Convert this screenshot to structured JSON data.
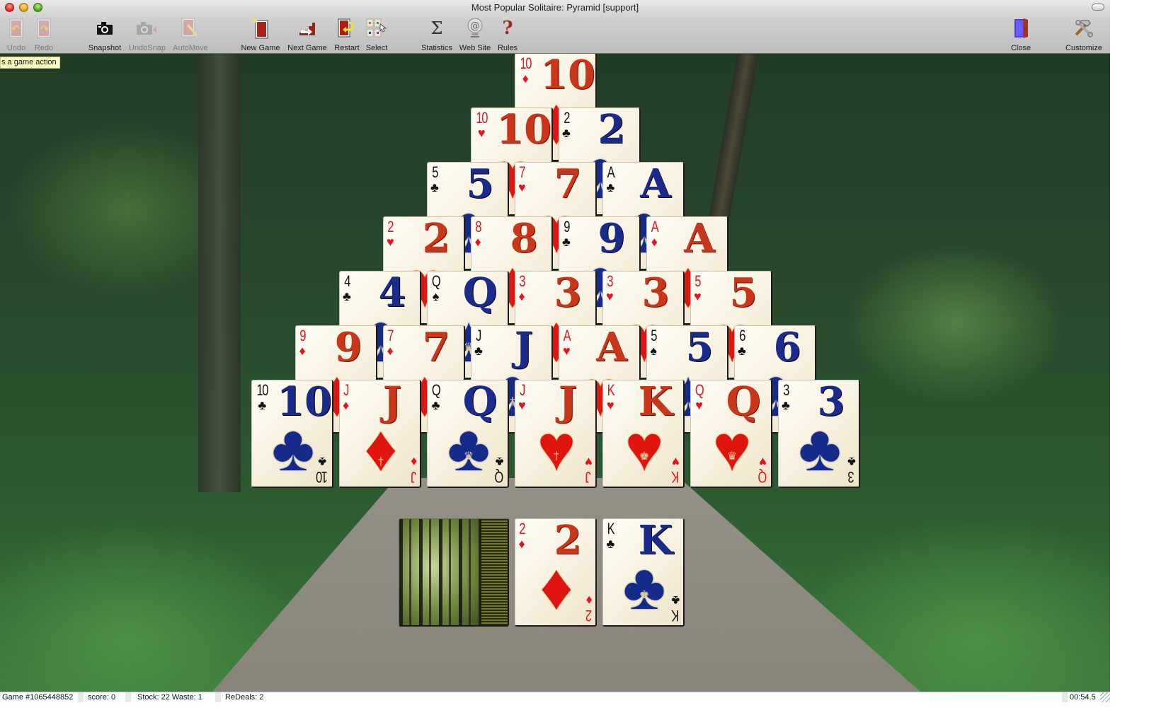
{
  "window": {
    "title": "Most Popular Solitaire: Pyramid [support]"
  },
  "toolbar": {
    "buttons": [
      {
        "id": "undo",
        "label": "Undo",
        "icon": "undo-icon",
        "enabled": false
      },
      {
        "id": "redo",
        "label": "Redo",
        "icon": "redo-icon",
        "enabled": false
      },
      {
        "id": "snapshot",
        "label": "Snapshot",
        "icon": "camera-icon",
        "enabled": true
      },
      {
        "id": "undosnap",
        "label": "UndoSnap",
        "icon": "camera-undo-icon",
        "enabled": false
      },
      {
        "id": "automove",
        "label": "AutoMove",
        "icon": "automove-icon",
        "enabled": false
      },
      {
        "id": "new-game",
        "label": "New Game",
        "icon": "new-game-icon",
        "enabled": true
      },
      {
        "id": "next-game",
        "label": "Next Game",
        "icon": "next-game-icon",
        "enabled": true
      },
      {
        "id": "restart",
        "label": "Restart",
        "icon": "restart-icon",
        "enabled": true
      },
      {
        "id": "select",
        "label": "Select",
        "icon": "select-icon",
        "enabled": true
      },
      {
        "id": "statistics",
        "label": "Statistics",
        "icon": "sigma-icon",
        "enabled": true
      },
      {
        "id": "web-site",
        "label": "Web Site",
        "icon": "at-sign-icon",
        "enabled": true
      },
      {
        "id": "rules",
        "label": "Rules",
        "icon": "question-mark-icon",
        "enabled": true
      },
      {
        "id": "close",
        "label": "Close",
        "icon": "door-icon",
        "enabled": true
      },
      {
        "id": "customize",
        "label": "Customize",
        "icon": "tools-icon",
        "enabled": true
      }
    ]
  },
  "tooltip": {
    "text": "s a game action"
  },
  "suits": {
    "hearts": {
      "glyph": "♥",
      "color": "red"
    },
    "diamonds": {
      "glyph": "♦",
      "color": "red"
    },
    "clubs": {
      "glyph": "♣",
      "color": "black"
    },
    "spades": {
      "glyph": "♠",
      "color": "black"
    }
  },
  "pyramid": {
    "rows": [
      [
        {
          "rank": "10",
          "suit": "diamonds"
        }
      ],
      [
        {
          "rank": "10",
          "suit": "hearts"
        },
        {
          "rank": "2",
          "suit": "clubs"
        }
      ],
      [
        {
          "rank": "5",
          "suit": "clubs"
        },
        {
          "rank": "7",
          "suit": "hearts"
        },
        {
          "rank": "A",
          "suit": "clubs"
        }
      ],
      [
        {
          "rank": "2",
          "suit": "hearts"
        },
        {
          "rank": "8",
          "suit": "diamonds"
        },
        {
          "rank": "9",
          "suit": "clubs"
        },
        {
          "rank": "A",
          "suit": "diamonds"
        }
      ],
      [
        {
          "rank": "4",
          "suit": "clubs"
        },
        {
          "rank": "Q",
          "suit": "spades"
        },
        {
          "rank": "3",
          "suit": "diamonds"
        },
        {
          "rank": "3",
          "suit": "hearts"
        },
        {
          "rank": "5",
          "suit": "hearts"
        }
      ],
      [
        {
          "rank": "9",
          "suit": "diamonds"
        },
        {
          "rank": "7",
          "suit": "diamonds"
        },
        {
          "rank": "J",
          "suit": "clubs"
        },
        {
          "rank": "A",
          "suit": "hearts"
        },
        {
          "rank": "5",
          "suit": "spades"
        },
        {
          "rank": "6",
          "suit": "clubs"
        }
      ],
      [
        {
          "rank": "10",
          "suit": "clubs"
        },
        {
          "rank": "J",
          "suit": "diamonds"
        },
        {
          "rank": "Q",
          "suit": "clubs"
        },
        {
          "rank": "J",
          "suit": "hearts"
        },
        {
          "rank": "K",
          "suit": "hearts"
        },
        {
          "rank": "Q",
          "suit": "hearts"
        },
        {
          "rank": "3",
          "suit": "clubs"
        }
      ]
    ]
  },
  "stock": {
    "face_down": true,
    "back_design": "forest"
  },
  "waste": [
    {
      "rank": "2",
      "suit": "diamonds"
    },
    {
      "rank": "K",
      "suit": "clubs"
    }
  ],
  "statusbar": {
    "game": "Game #1065448852",
    "score": "score: 0",
    "stock_waste": "Stock: 22  Waste: 1",
    "redeals": "ReDeals: 2",
    "timer": "00:54.5"
  }
}
